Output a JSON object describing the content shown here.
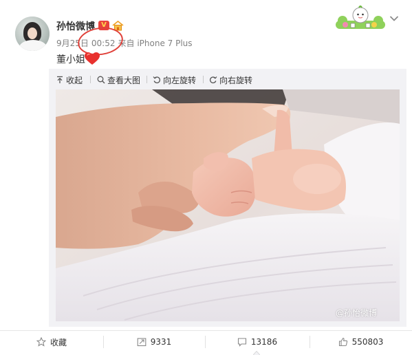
{
  "post": {
    "username": "孙怡微博",
    "vip_badge": "V",
    "date": "9月25日",
    "time": "00:52",
    "source": "来自 iPhone 7 Plus",
    "text": "董小姐",
    "text_emoji": "heart",
    "watermark": "@孙怡微博"
  },
  "image_toolbar": {
    "collapse": "收起",
    "view_large": "查看大图",
    "rotate_left": "向左旋转",
    "rotate_right": "向右旋转"
  },
  "actions": {
    "favorite": "收藏",
    "repost": "9331",
    "comment": "13186",
    "like": "550803"
  },
  "icons": [
    "avatar",
    "vip-badge-icon",
    "house-icon",
    "heart-icon",
    "sticker-icon",
    "chevron-down-icon",
    "collapse-icon",
    "search-icon",
    "rotate-left-icon",
    "rotate-right-icon",
    "star-icon",
    "repost-icon",
    "comment-icon",
    "thumbs-up-icon"
  ],
  "colors": {
    "annotation_circle": "#e0413a",
    "toolbar_bg": "#f2f2f5",
    "text_primary": "#333333",
    "text_meta": "#808080",
    "heart": "#e8312e"
  }
}
